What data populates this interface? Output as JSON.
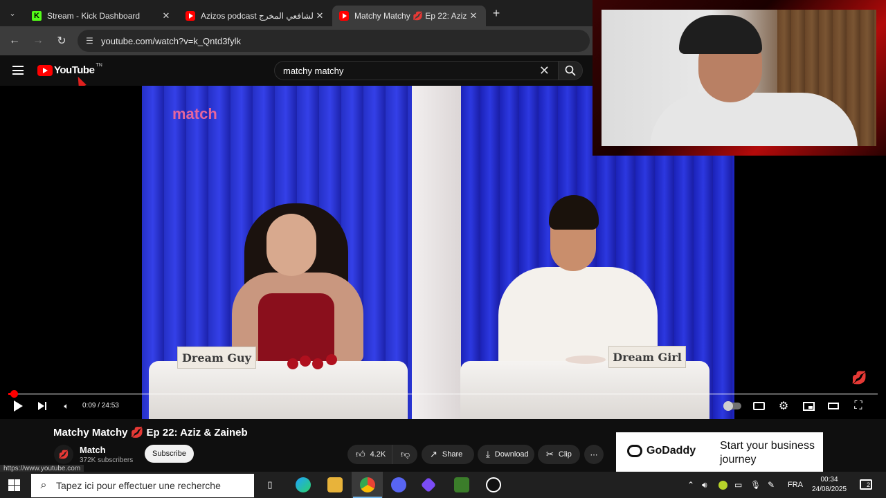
{
  "browser": {
    "tabs": [
      {
        "title": "Stream - Kick Dashboard",
        "favicon": "kick-icon",
        "active": false
      },
      {
        "title": "Azizos podcast الشافعي المخرج",
        "favicon": "youtube-icon",
        "active": false
      },
      {
        "title": "Matchy Matchy 💋 Ep 22: Aziz",
        "favicon": "youtube-icon",
        "active": true
      }
    ],
    "url": "youtube.com/watch?v=k_Qntd3fylk"
  },
  "youtube": {
    "logo_text": "YouTube",
    "logo_region": "TN",
    "search_value": "matchy matchy"
  },
  "video": {
    "overlay_logo": "match",
    "nameplate_left": "Dream Guy",
    "nameplate_right": "Dream Girl",
    "time_current": "0:09",
    "time_total": "24:53",
    "time_display": "0:09 / 24:53",
    "progress": 0.006,
    "title": "Matchy Matchy 💋 Ep 22: Aziz & Zaineb"
  },
  "channel": {
    "name": "Match",
    "subscribers": "372K subscribers",
    "subscribe_label": "Subscribe"
  },
  "actions": {
    "like_count": "4.2K",
    "share_label": "Share",
    "download_label": "Download",
    "clip_label": "Clip"
  },
  "status_bar_url": "https://www.youtube.com",
  "ad": {
    "brand": "GoDaddy",
    "headline": "Start your business journey"
  },
  "taskbar": {
    "search_placeholder": "Tapez ici pour effectuer une recherche",
    "language": "FRA",
    "time": "00:34",
    "date": "24/08/2025",
    "notification_count": "2"
  },
  "colors": {
    "youtube_red": "#ff0000",
    "kick_green": "#53fc18",
    "match_pink": "#e5669d",
    "background": "#0f0f0f"
  }
}
